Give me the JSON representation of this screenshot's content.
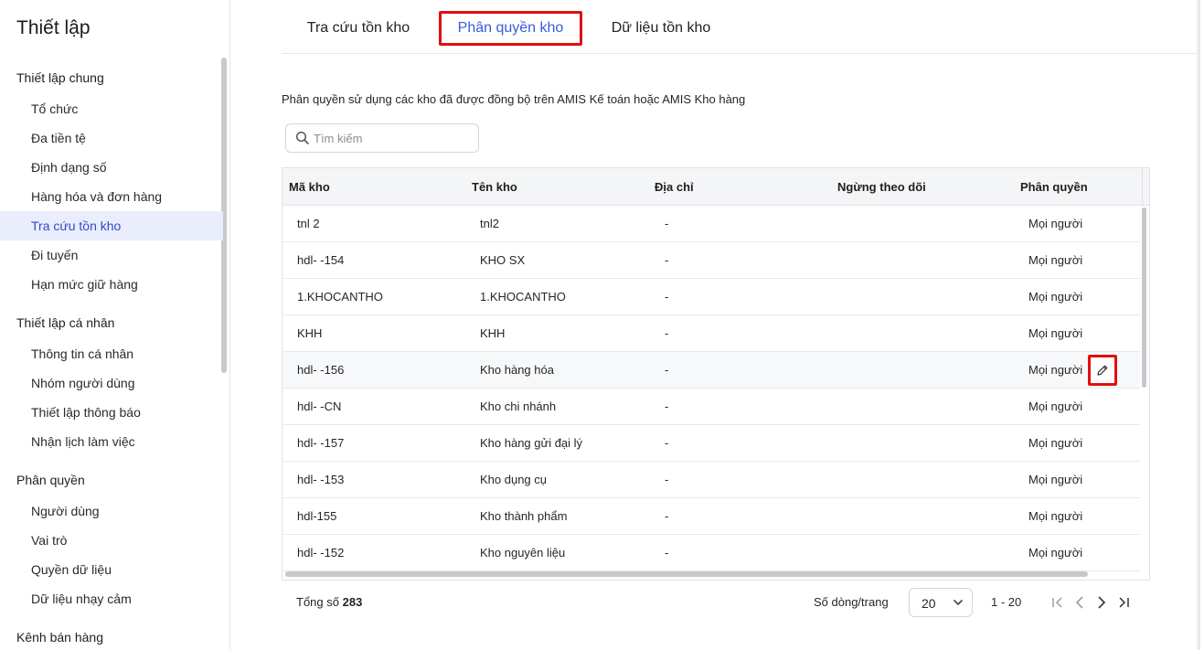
{
  "sidebar": {
    "title": "Thiết lập",
    "groups": [
      {
        "title": "Thiết lập chung",
        "items": [
          "Tổ chức",
          "Đa tiền tệ",
          "Định dạng số",
          "Hàng hóa và đơn hàng",
          "Tra cứu tồn kho",
          "Đi tuyến",
          "Hạn mức giữ hàng"
        ]
      },
      {
        "title": "Thiết lập cá nhân",
        "items": [
          "Thông tin cá nhân",
          "Nhóm người dùng",
          "Thiết lập thông báo",
          "Nhận lịch làm việc"
        ]
      },
      {
        "title": "Phân quyền",
        "items": [
          "Người dùng",
          "Vai trò",
          "Quyền dữ liệu",
          "Dữ liệu nhạy cảm"
        ]
      },
      {
        "title": "Kênh bán hàng",
        "items": []
      }
    ],
    "active_item": "Tra cứu tồn kho"
  },
  "tabs": [
    {
      "label": "Tra cứu tồn kho",
      "active": false
    },
    {
      "label": "Phân quyền kho",
      "active": true
    },
    {
      "label": "Dữ liệu tồn kho",
      "active": false
    }
  ],
  "description": "Phân quyền sử dụng các kho đã được đồng bộ trên AMIS Kế toán hoặc AMIS Kho hàng",
  "search": {
    "placeholder": "Tìm kiếm",
    "value": ""
  },
  "table": {
    "columns": [
      "Mã kho",
      "Tên kho",
      "Địa chỉ",
      "Ngừng theo dõi",
      "Phân quyền"
    ],
    "rows": [
      {
        "code": "tnl 2",
        "name": "tnl2",
        "address": "-",
        "inactive": "",
        "permission": "Mọi người"
      },
      {
        "code": "hdl- -154",
        "name": "KHO SX",
        "address": "-",
        "inactive": "",
        "permission": "Mọi người"
      },
      {
        "code": "1.KHOCANTHO",
        "name": "1.KHOCANTHO",
        "address": "-",
        "inactive": "",
        "permission": "Mọi người"
      },
      {
        "code": "KHH",
        "name": "KHH",
        "address": "-",
        "inactive": "",
        "permission": "Mọi người"
      },
      {
        "code": "hdl- -156",
        "name": "Kho hàng hóa",
        "address": "-",
        "inactive": "",
        "permission": "Mọi người"
      },
      {
        "code": "hdl- -CN",
        "name": "Kho chi nhánh",
        "address": "-",
        "inactive": "",
        "permission": "Mọi người"
      },
      {
        "code": "hdl- -157",
        "name": "Kho hàng gửi đại lý",
        "address": "-",
        "inactive": "",
        "permission": "Mọi người"
      },
      {
        "code": "hdl- -153",
        "name": "Kho dụng cụ",
        "address": "-",
        "inactive": "",
        "permission": "Mọi người"
      },
      {
        "code": "hdl-155",
        "name": "Kho thành phẩm",
        "address": "-",
        "inactive": "",
        "permission": "Mọi người"
      },
      {
        "code": "hdl- -152",
        "name": "Kho nguyên liệu",
        "address": "-",
        "inactive": "",
        "permission": "Mọi người"
      }
    ],
    "hover_row": 4,
    "edit_icon": "pencil-icon"
  },
  "footer": {
    "total_label": "Tổng số",
    "total_value": "283",
    "rows_per_page_label": "Số dòng/trang",
    "rows_per_page_value": "20",
    "range": "1 - 20"
  },
  "colors": {
    "accent": "#3a5bd9",
    "highlight_border": "#e01010",
    "active_bg": "#eaedfb"
  }
}
